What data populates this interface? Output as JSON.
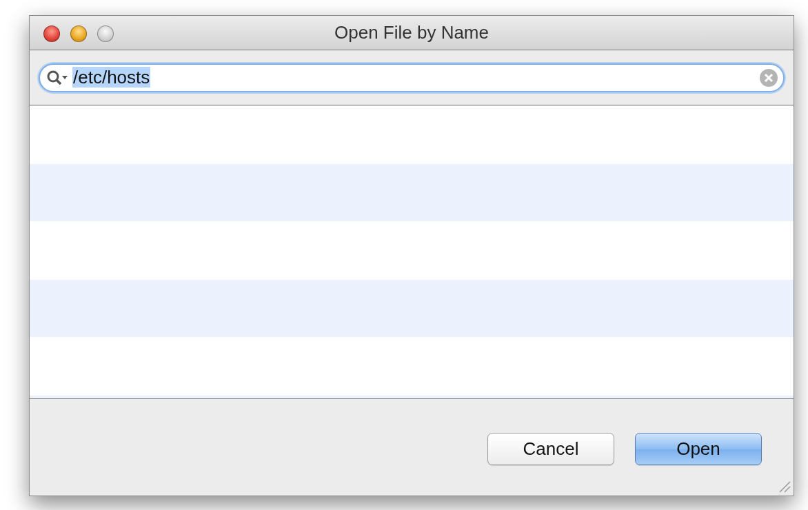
{
  "window": {
    "title": "Open File by Name",
    "controls": [
      {
        "kind": "close",
        "disabled": false
      },
      {
        "kind": "minimize",
        "disabled": false
      },
      {
        "kind": "zoom",
        "disabled": true
      }
    ]
  },
  "search": {
    "value": "/etc/hosts",
    "text_selected": true
  },
  "buttons": [
    {
      "label": "Cancel",
      "default": false
    },
    {
      "label": "Open",
      "default": true
    }
  ]
}
